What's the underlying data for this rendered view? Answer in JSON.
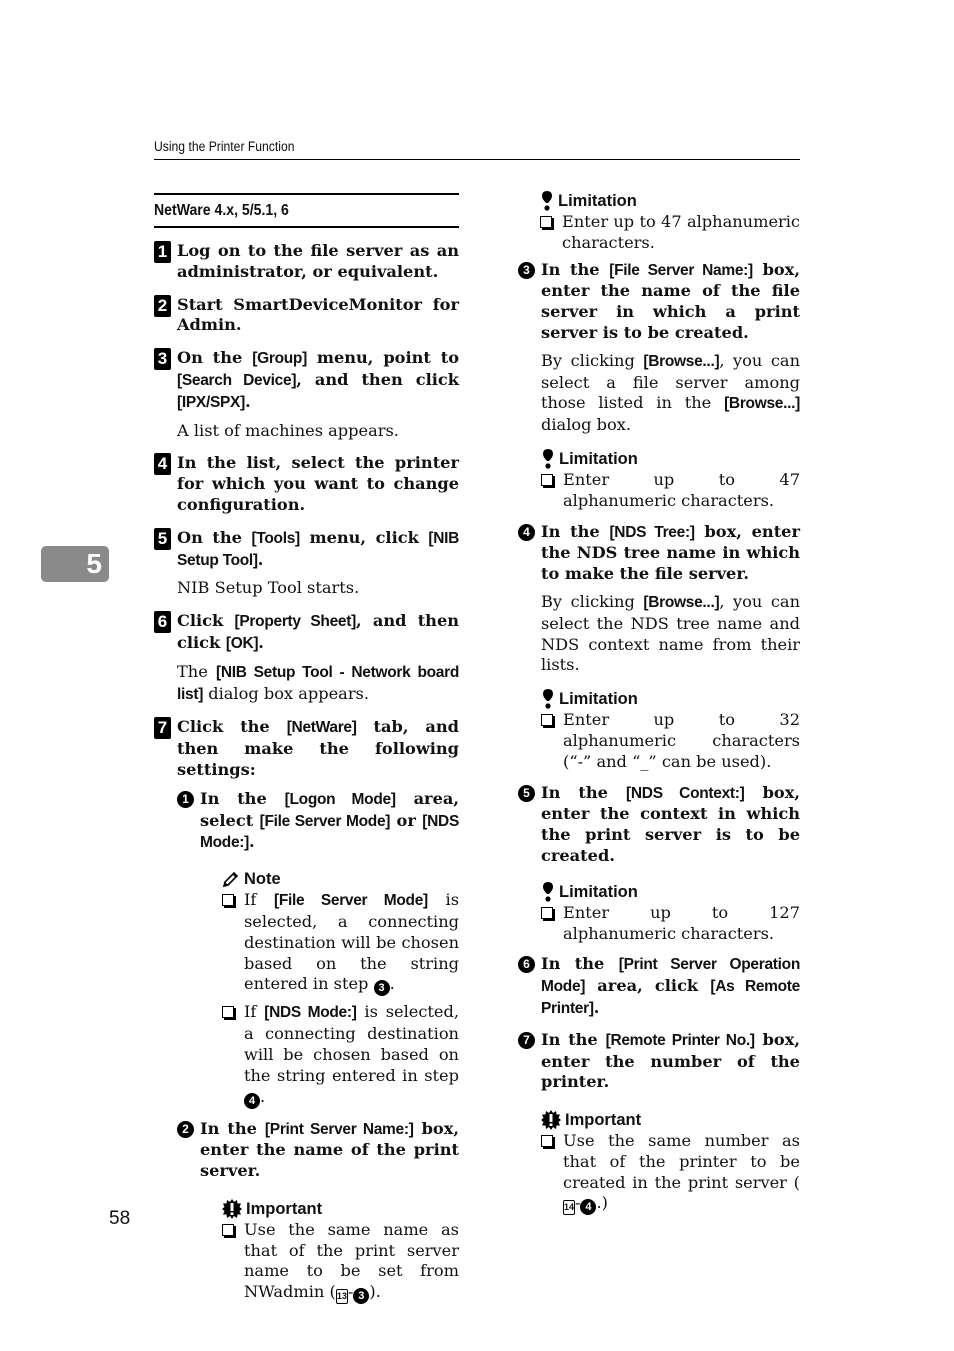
{
  "header": {
    "running_title": "Using the Printer Function"
  },
  "chapter_tab": "5",
  "page_number": "58",
  "section_title": "NetWare 4.x, 5/5.1, 6",
  "steps": [
    {
      "n": "1",
      "title": "Log on to the file server as an administrator, or equivalent."
    },
    {
      "n": "2",
      "title": "Start SmartDeviceMonitor for Admin."
    },
    {
      "n": "3",
      "t1": "On the ",
      "ui1": "[Group]",
      "t2": " menu, point to ",
      "ui2": "[Search Device]",
      "t3": ", and then click ",
      "ui3": "[IPX/SPX]",
      "t4": ".",
      "body": "A list of machines appears."
    },
    {
      "n": "4",
      "title": "In the list, select the printer for which you want to change configuration."
    },
    {
      "n": "5",
      "t1": "On the ",
      "ui1": "[Tools]",
      "t2": " menu, click ",
      "ui2": "[NIB Setup Tool]",
      "t3": ".",
      "body": "NIB Setup Tool starts."
    },
    {
      "n": "6",
      "t1": "Click ",
      "ui1": "[Property Sheet]",
      "t2": ", and then click ",
      "ui2": "[OK]",
      "t3": ".",
      "b1": "The ",
      "bui": "[NIB Setup Tool - Network board list]",
      "b2": " dialog box appears."
    },
    {
      "n": "7",
      "t1": "Click the ",
      "ui1": "[NetWare]",
      "t2": " tab, and then make the following settings:"
    }
  ],
  "substeps": [
    {
      "n": "1",
      "t1": "In the ",
      "ui1": "[Logon Mode]",
      "t2": " area, select ",
      "ui2": "[File Server Mode]",
      "t3": " or ",
      "ui3": "[NDS Mode:]",
      "t4": "."
    },
    {
      "n": "2",
      "t1": "In the ",
      "ui1": "[Print Server Name:]",
      "t2": " box, enter the name of the print server."
    },
    {
      "n": "3",
      "t1": "In the ",
      "ui1": "[File Server Name:]",
      "t2": " box, enter the name of the file server in which a print server is to be created.",
      "b1": "By clicking ",
      "bui1": "[Browse...]",
      "b2": ", you can select a file server among those listed in the ",
      "bui2": "[Browse...]",
      "b3": " dialog box."
    },
    {
      "n": "4",
      "t1": "In the ",
      "ui1": "[NDS Tree:]",
      "t2": " box, enter the NDS tree name in which to make the file server.",
      "b1": "By clicking ",
      "bui1": "[Browse...]",
      "b2": ", you can select the NDS tree name and NDS context name from their lists."
    },
    {
      "n": "5",
      "t1": "In the ",
      "ui1": "[NDS Context:]",
      "t2": " box, enter the context in which the print server is to be created."
    },
    {
      "n": "6",
      "t1": "In the ",
      "ui1": "[Print Server Operation Mode]",
      "t2": " area, click ",
      "ui2": "[As Remote Printer]",
      "t3": "."
    },
    {
      "n": "7",
      "t1": "In the ",
      "ui1": "[Remote Printer No.]",
      "t2": " box, enter the number of the printer."
    }
  ],
  "note": {
    "label": "Note",
    "items": [
      {
        "t1": "If ",
        "ui": "[File Server Mode]",
        "t2": " is selected, a connecting destination will be chosen based on the string entered in step ",
        "ref": "3",
        "t3": "."
      },
      {
        "t1": "If ",
        "ui": "[NDS Mode:]",
        "t2": " is selected, a connecting destination will be chosen based on the string entered in step ",
        "ref": "4",
        "t3": "."
      }
    ]
  },
  "important_1": {
    "label": "Important",
    "t1": "Use the same name as that of the print server name to be set from NWadmin (",
    "ref_step": "13",
    "ref_sub": "3",
    "t2": ")."
  },
  "limitation_1": {
    "label": "Limitation",
    "text": "Enter up to 47 alphanumeric characters."
  },
  "limitation_2": {
    "label": "Limitation",
    "text": "Enter up to 47 alphanumeric characters."
  },
  "limitation_3": {
    "label": "Limitation",
    "text": "Enter up to 32 alphanumeric characters (“-” and “_” can be used)."
  },
  "limitation_4": {
    "label": "Limitation",
    "text": "Enter up to 127 alphanumeric characters."
  },
  "important_2": {
    "label": "Important",
    "t1": "Use the same number as that of the printer to be created in the print server (",
    "ref_step": "14",
    "ref_sub": "4",
    "t2": ".)"
  }
}
